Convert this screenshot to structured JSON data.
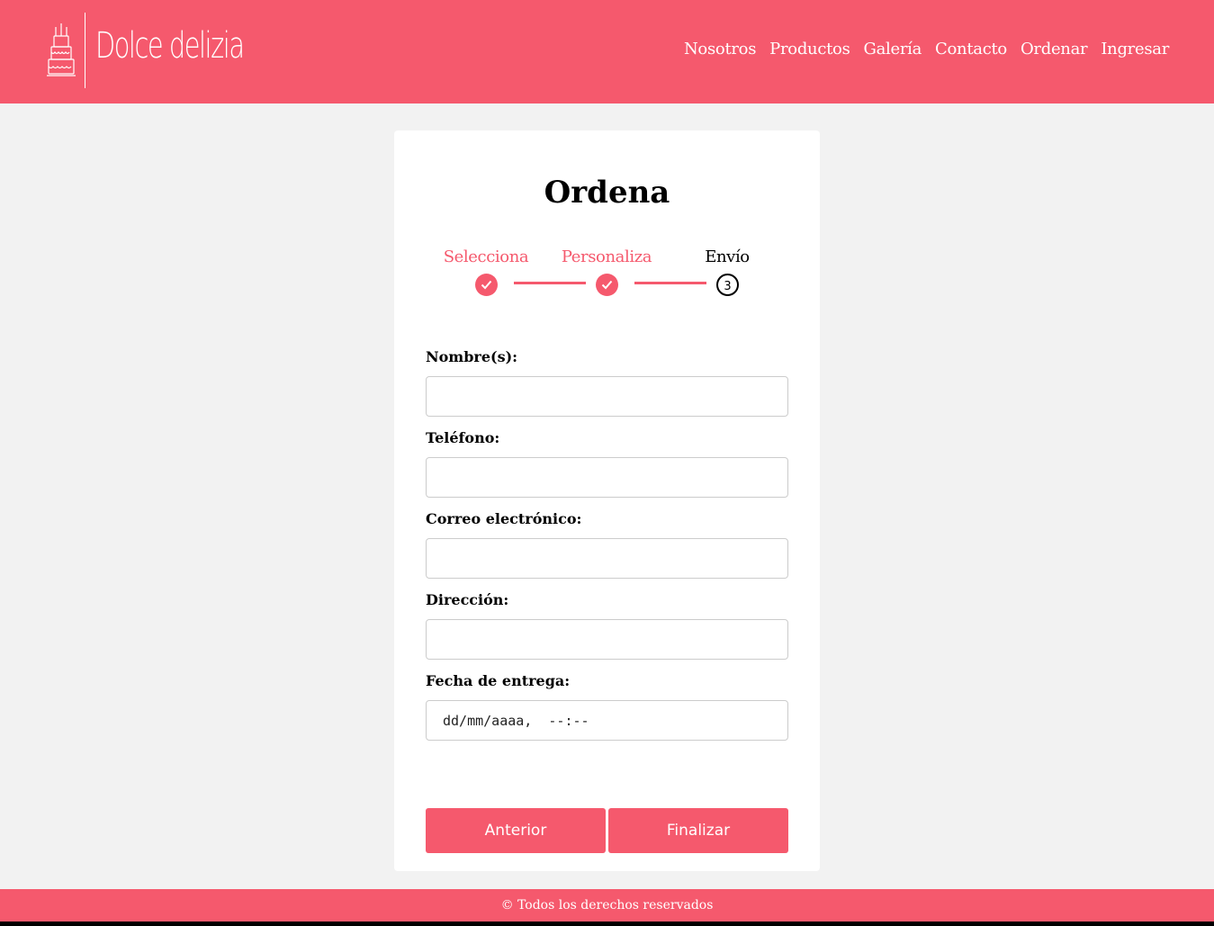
{
  "brand": {
    "name": "Dolce delizia"
  },
  "nav": {
    "items": [
      "Nosotros",
      "Productos",
      "Galería",
      "Contacto",
      "Ordenar",
      "Ingresar"
    ]
  },
  "page": {
    "title": "Ordena"
  },
  "steps": [
    {
      "label": "Selecciona",
      "state": "done"
    },
    {
      "label": "Personaliza",
      "state": "done"
    },
    {
      "label": "Envío",
      "state": "current",
      "number": "3"
    }
  ],
  "form": {
    "nombre_label": "Nombre(s):",
    "telefono_label": "Teléfono:",
    "correo_label": "Correo electrónico:",
    "direccion_label": "Dirección:",
    "fecha_label": "Fecha de entrega:",
    "fecha_placeholder": "dd/mm/aaaa,  --:--"
  },
  "buttons": {
    "previous": "Anterior",
    "finish": "Finalizar"
  },
  "footer": {
    "text": "© Todos los derechos reservados"
  },
  "colors": {
    "accent": "#f5596d",
    "background": "#f2f2f2",
    "card": "#ffffff"
  }
}
